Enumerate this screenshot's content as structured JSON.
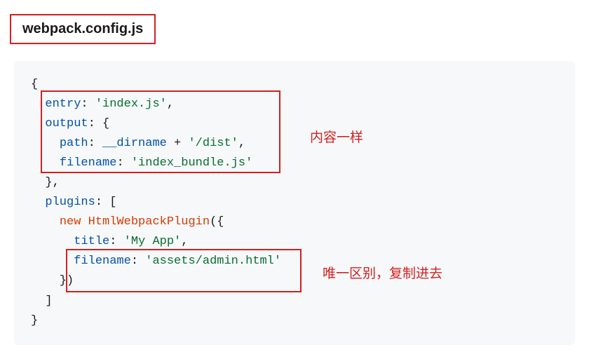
{
  "filename": "webpack.config.js",
  "code": {
    "line1": "{",
    "l2_key": "entry",
    "l2_sep": ": ",
    "l2_val": "'index.js'",
    "l2_end": ",",
    "l3_key": "output",
    "l3_sep": ": {",
    "l4_key": "path",
    "l4_sep": ": ",
    "l4_id": "__dirname",
    "l4_plus": " + ",
    "l4_val": "'/dist'",
    "l4_end": ",",
    "l5_key": "filename",
    "l5_sep": ": ",
    "l5_val": "'index_bundle.js'",
    "l6": "  },",
    "l7_key": "plugins",
    "l7_sep": ": [",
    "l8_new": "new",
    "l8_sp": " ",
    "l8_class": "HtmlWebpackPlugin",
    "l8_par": "({",
    "l9_key": "title",
    "l9_sep": ": ",
    "l9_val": "'My App'",
    "l9_end": ",",
    "l10_key": "filename",
    "l10_sep": ": ",
    "l10_val": "'assets/admin.html'",
    "l11": "    })",
    "l12": "  ]",
    "l13": "}"
  },
  "annotations": {
    "a1": "内容一样",
    "a2": "唯一区别，复制进去"
  }
}
